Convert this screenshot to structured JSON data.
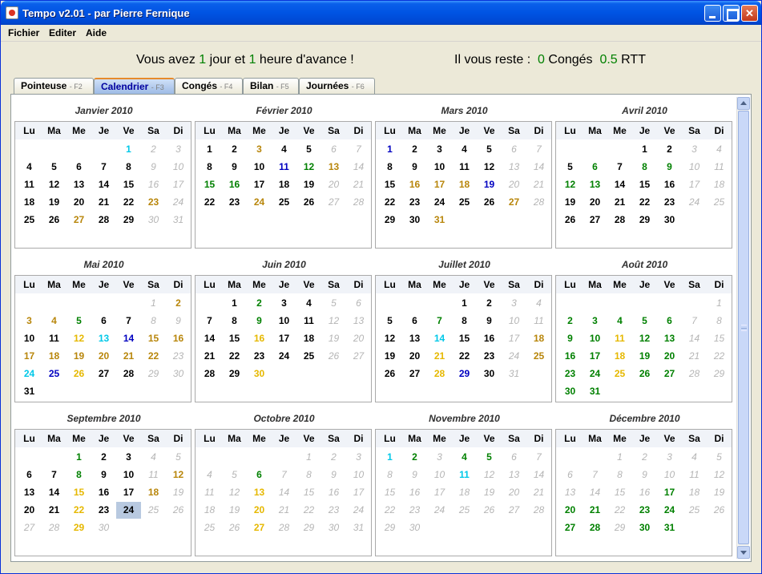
{
  "window": {
    "title": "Tempo v2.01 - par Pierre Fernique"
  },
  "menu": {
    "fichier": "Fichier",
    "editer": "Editer",
    "aide": "Aide"
  },
  "status": {
    "avance_part1": "Vous avez",
    "jours": "1",
    "avance_part2": "jour et",
    "heures": "1",
    "avance_part3": "heure d'avance !",
    "reste_label": "Il vous reste :",
    "conges": "0",
    "conges_label": "Congés",
    "rtt": "0.5",
    "rtt_label": "RTT"
  },
  "tabs": [
    {
      "label": "Pointeuse",
      "key": "- F2"
    },
    {
      "label": "Calendrier",
      "key": "- F3"
    },
    {
      "label": "Congés",
      "key": "- F4"
    },
    {
      "label": "Bilan",
      "key": "- F5"
    },
    {
      "label": "Journées",
      "key": "- F6"
    }
  ],
  "active_tab": "Calendrier",
  "weekdays": [
    "Lu",
    "Ma",
    "Me",
    "Je",
    "Ve",
    "Sa",
    "Di"
  ],
  "colors": {
    "k": "#000000",
    "g": "#008000",
    "o": "#b8860b",
    "y": "#e6b800",
    "c": "#00c8e8",
    "b": "#0000c0",
    "l": "#a0a0a0",
    "we": "#b5b5b5"
  },
  "today": {
    "month": 8,
    "day": 24
  },
  "months": [
    {
      "title": "Janvier 2010",
      "start": 4,
      "days": 31,
      "colors": {
        "1": "c",
        "23": "o",
        "27": "o"
      }
    },
    {
      "title": "Février 2010",
      "start": 0,
      "days": 28,
      "colors": {
        "3": "o",
        "11": "b",
        "12": "g",
        "13": "o",
        "15": "g",
        "16": "g",
        "24": "o"
      }
    },
    {
      "title": "Mars 2010",
      "start": 0,
      "days": 31,
      "colors": {
        "1": "b",
        "16": "o",
        "17": "o",
        "18": "o",
        "19": "b",
        "27": "o",
        "31": "o"
      }
    },
    {
      "title": "Avril 2010",
      "start": 3,
      "days": 30,
      "colors": {
        "6": "g",
        "8": "g",
        "9": "g",
        "12": "g",
        "13": "g"
      }
    },
    {
      "title": "Mai 2010",
      "start": 5,
      "days": 31,
      "colors": {
        "2": "o",
        "3": "o",
        "4": "o",
        "5": "g",
        "12": "y",
        "13": "c",
        "14": "b",
        "15": "o",
        "16": "o",
        "17": "o",
        "18": "o",
        "19": "o",
        "20": "o",
        "21": "o",
        "22": "o",
        "24": "c",
        "25": "b",
        "26": "y"
      }
    },
    {
      "title": "Juin 2010",
      "start": 1,
      "days": 30,
      "colors": {
        "2": "g",
        "9": "g",
        "16": "y",
        "30": "y"
      }
    },
    {
      "title": "Juillet 2010",
      "start": 3,
      "days": 31,
      "colors": {
        "7": "g",
        "14": "c",
        "18": "o",
        "21": "y",
        "25": "o",
        "28": "y",
        "29": "b"
      }
    },
    {
      "title": "Août 2010",
      "start": 6,
      "days": 31,
      "colors": {
        "2": "g",
        "3": "g",
        "4": "g",
        "5": "g",
        "6": "g",
        "9": "g",
        "10": "g",
        "11": "y",
        "12": "g",
        "13": "g",
        "16": "g",
        "17": "g",
        "18": "y",
        "19": "g",
        "20": "g",
        "23": "g",
        "24": "g",
        "25": "y",
        "26": "g",
        "27": "g",
        "30": "g",
        "31": "g"
      }
    },
    {
      "title": "Septembre 2010",
      "start": 2,
      "days": 30,
      "colors": {
        "1": "g",
        "8": "g",
        "12": "o",
        "15": "y",
        "18": "o",
        "22": "y",
        "29": "y"
      },
      "future_from": 25
    },
    {
      "title": "Octobre 2010",
      "start": 4,
      "days": 31,
      "colors": {
        "6": "g",
        "13": "y",
        "20": "y",
        "27": "y"
      },
      "future_all": true
    },
    {
      "title": "Novembre 2010",
      "start": 0,
      "days": 30,
      "colors": {
        "1": "c",
        "2": "g",
        "4": "g",
        "5": "g",
        "11": "c"
      },
      "future_all": true
    },
    {
      "title": "Décembre 2010",
      "start": 2,
      "days": 31,
      "colors": {
        "17": "g",
        "20": "g",
        "21": "g",
        "23": "g",
        "24": "g",
        "27": "g",
        "28": "g",
        "30": "g",
        "31": "g"
      },
      "future_all": true
    }
  ]
}
